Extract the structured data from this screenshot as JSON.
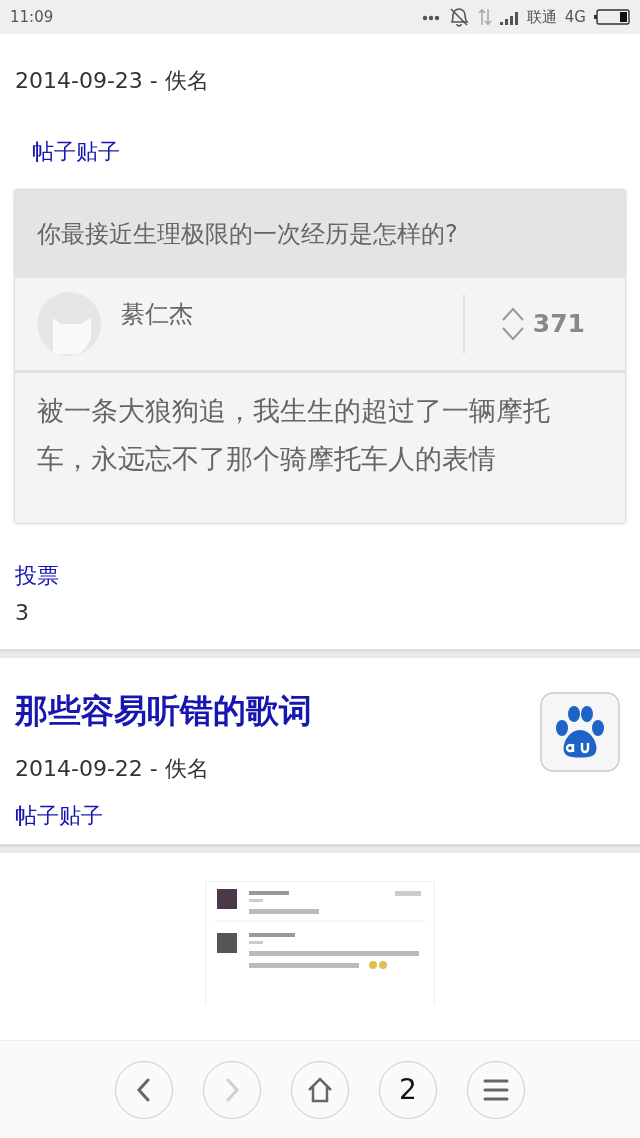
{
  "status_bar": {
    "time": "11:09",
    "carrier": "联通",
    "network": "4G"
  },
  "first_article": {
    "date_author": "2014-09-23 - 佚名",
    "tag": "帖子贴子",
    "embedded_post": {
      "question": "你最接近生理极限的一次经历是怎样的?",
      "author": "綦仁杰",
      "votes": "371",
      "answer": "被一条大狼狗追，我生生的超过了一辆摩托车，永远忘不了那个骑摩托车人的表情"
    },
    "vote_label": "投票",
    "vote_count": "3"
  },
  "second_article": {
    "title": "那些容易听错的歌词",
    "date_author": "2014-09-22 - 佚名",
    "tag": "帖子贴子"
  },
  "toolbar": [
    {
      "kind": "back",
      "disabled": false
    },
    {
      "kind": "forward",
      "disabled": true
    },
    {
      "kind": "home",
      "disabled": false
    },
    {
      "kind": "tabs",
      "label": "2",
      "disabled": false
    },
    {
      "kind": "menu",
      "disabled": false
    }
  ]
}
